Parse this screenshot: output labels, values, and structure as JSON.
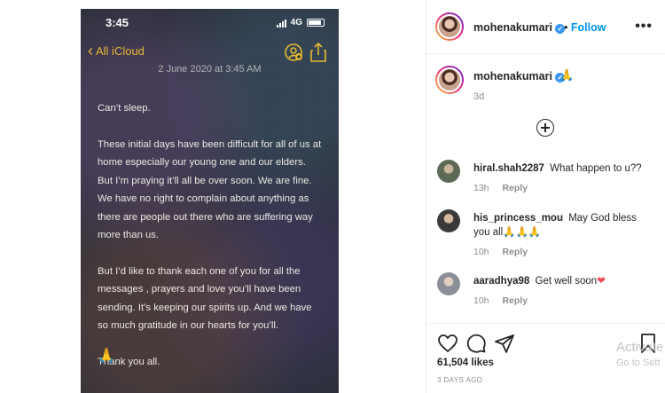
{
  "phone": {
    "status_time": "3:45",
    "network": "4G",
    "back_label": "All iCloud",
    "note_date": "2 June 2020 at 3:45 AM",
    "paragraphs": [
      "Can’t sleep.",
      "These initial days have been difficult for all of us at home especially our young one and our elders. But I’m praying it’ll all be over soon. We are fine. We have no right to complain about anything as there are people out there who are suffering way more than us.",
      "But I’d like to thank each one of you for all the messages , prayers and love you’ll have been sending. It’s keeping our spirits up. And we have so much gratitude in our hearts for you’ll.",
      "Thank you all."
    ],
    "sign_emoji": "🙏"
  },
  "post": {
    "username": "mohenakumari",
    "follow_label": "Follow",
    "more_label": "•••",
    "caption_emoji": "🙏",
    "caption_time": "3d",
    "likes": "61,504 likes",
    "date": "3 DAYS AGO",
    "watermark_title": "Activate",
    "watermark_sub": "Go to Sett"
  },
  "comments": [
    {
      "user": "hiral.shah2287",
      "text": "What happen to u??",
      "time": "13h",
      "reply": "Reply"
    },
    {
      "user": "his_princess_mou",
      "text": "May God bless you all",
      "emojis": "🙏🙏🙏",
      "time": "10h",
      "reply": "Reply"
    },
    {
      "user": "aaradhya98",
      "text": "Get well soon",
      "emojis": "❤",
      "time": "10h",
      "reply": "Reply"
    }
  ]
}
